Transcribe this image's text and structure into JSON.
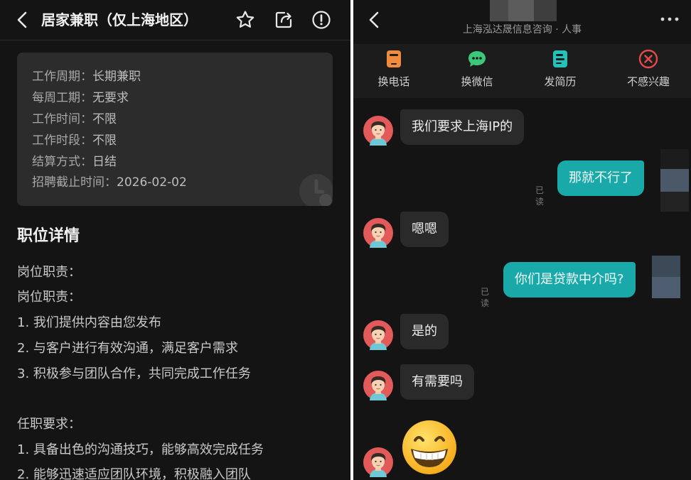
{
  "left": {
    "title": "居家兼职（仅上海地区）",
    "info": [
      {
        "label": "工作周期：",
        "value": "长期兼职"
      },
      {
        "label": "每周工期：",
        "value": "无要求"
      },
      {
        "label": "工作时间：",
        "value": "不限"
      },
      {
        "label": "工作时段：",
        "value": "不限"
      },
      {
        "label": "结算方式：",
        "value": "日结"
      },
      {
        "label": "招聘截止时间：",
        "value": "2026-02-02"
      }
    ],
    "section_title": "职位详情",
    "description": [
      "岗位职责：",
      "岗位职责：",
      "1. 我们提供内容由您发布",
      "2. 与客户进行有效沟通，满足客户需求",
      "3. 积极参与团队合作，共同完成工作任务",
      "",
      "任职要求：",
      "1. 具备出色的沟通技巧，能够高效完成任务",
      "2. 能够迅速适应团队环境，积极融入团队"
    ]
  },
  "right": {
    "subtitle": "上海泓达晟信息咨询 · 人事",
    "actions": [
      {
        "label": "换电话",
        "icon": "phone-icon"
      },
      {
        "label": "换微信",
        "icon": "wechat-icon"
      },
      {
        "label": "发简历",
        "icon": "resume-icon"
      },
      {
        "label": "不感兴趣",
        "icon": "not-interested-icon"
      }
    ],
    "messages": [
      {
        "from": "recruiter",
        "text": "我们要求上海IP的"
      },
      {
        "from": "me",
        "text": "那就不行了",
        "status": "已读"
      },
      {
        "from": "recruiter",
        "text": "嗯嗯"
      },
      {
        "from": "me",
        "text": "你们是贷款中介吗?",
        "status": "已读"
      },
      {
        "from": "recruiter",
        "text": "是的"
      },
      {
        "from": "recruiter",
        "text": "有需要吗"
      },
      {
        "from": "recruiter",
        "emoji": "grinning-face-emoji"
      }
    ]
  },
  "colors": {
    "background": "#141414",
    "card": "#2c2c2c",
    "outgoing_bubble": "#1aa9a9",
    "incoming_bubble": "#2a2a2a",
    "not_interested": "#e24a4a",
    "resume": "#22c3b8"
  }
}
